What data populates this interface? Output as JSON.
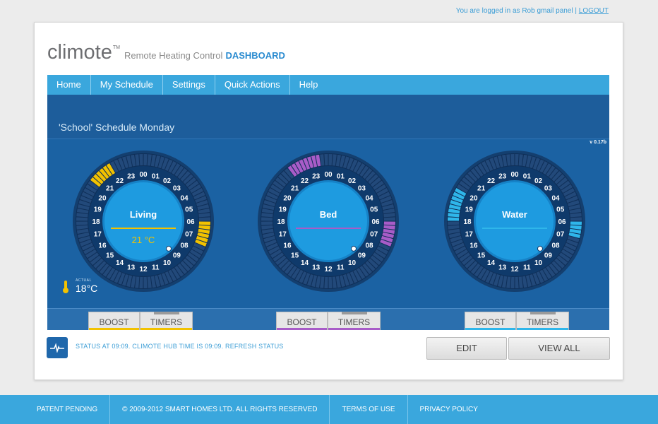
{
  "topbar": {
    "login_text": "You are logged in as Rob gmail panel |",
    "logout": "LOGOUT"
  },
  "brand": {
    "name": "climote",
    "tm": "TM",
    "tagline": "Remote Heating Control",
    "dashboard": "DASHBOARD"
  },
  "nav": {
    "items": [
      "Home",
      "My Schedule",
      "Settings",
      "Quick Actions",
      "Help"
    ]
  },
  "schedule": {
    "title": "'School' Schedule Monday",
    "version": "v 0.17b"
  },
  "hours": [
    "00",
    "01",
    "02",
    "03",
    "04",
    "05",
    "06",
    "07",
    "08",
    "09",
    "10",
    "11",
    "12",
    "13",
    "14",
    "15",
    "16",
    "17",
    "18",
    "19",
    "20",
    "21",
    "22",
    "23"
  ],
  "zones": [
    {
      "name": "Living",
      "temp": "21 °C",
      "color": "#f2c200",
      "active_hours": [
        6.0,
        7.5,
        20.5,
        22.0
      ]
    },
    {
      "name": "Bed",
      "temp": "",
      "color": "#a85cc8",
      "active_hours": [
        6.0,
        7.5,
        21.5,
        23.5
      ]
    },
    {
      "name": "Water",
      "temp": "",
      "color": "#2fb6ea",
      "active_hours": [
        6.0,
        7.0,
        18.0,
        20.0
      ]
    }
  ],
  "actual": {
    "label": "ACTUAL",
    "value": "18°C"
  },
  "buttons": {
    "boost": "BOOST",
    "timers": "TIMERS",
    "edit": "EDIT",
    "view_all": "VIEW ALL"
  },
  "status": {
    "text": "STATUS AT 09:09. CLIMOTE HUB TIME IS 09:09. REFRESH STATUS"
  },
  "footer": {
    "patent": "PATENT PENDING",
    "copyright": "© 2009-2012 SMART HOMES LTD. ALL RIGHTS RESERVED",
    "terms": "TERMS OF USE",
    "privacy": "PRIVACY POLICY"
  },
  "colors": {
    "nav_blue": "#3aa7dd",
    "panel_blue": "#1b62a3",
    "dial_dark": "#0f2f58"
  },
  "current_time": "09:09"
}
